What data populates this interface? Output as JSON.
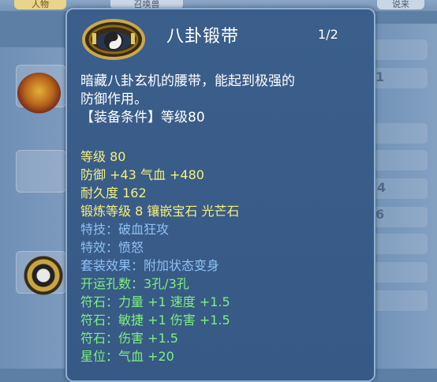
{
  "background": {
    "tabs": [
      "人物",
      "召唤兽",
      "说来"
    ],
    "digits": [
      "1",
      "4",
      "6"
    ]
  },
  "tooltip": {
    "item_name": "八卦锻带",
    "page_indicator": "1/2",
    "description_lines": [
      "暗藏八卦玄机的腰带，能起到极强的",
      "防御作用。"
    ],
    "requirement": "【装备条件】等级80",
    "stats": [
      {
        "text": "等级 80",
        "color": "yellow"
      },
      {
        "text": "防御 +43 气血 +480",
        "color": "yellow"
      },
      {
        "text": "耐久度 162",
        "color": "yellow"
      },
      {
        "text": "锻炼等级 8  镶嵌宝石 光芒石",
        "color": "yellow"
      },
      {
        "text": "特技：破血狂攻",
        "color": "blue"
      },
      {
        "text": "特效：愤怒",
        "color": "blue"
      },
      {
        "text": "套装效果：附加状态变身",
        "color": "blue"
      },
      {
        "text": "开运孔数：3孔/3孔",
        "color": "green"
      },
      {
        "text": "符石：力量 +1 速度 +1.5",
        "color": "green"
      },
      {
        "text": "符石：敏捷 +1 伤害 +1.5",
        "color": "green"
      },
      {
        "text": "符石：伤害 +1.5",
        "color": "green"
      },
      {
        "text": "星位：气血 +20",
        "color": "green"
      }
    ]
  },
  "colors": {
    "yellow": "#f5f17a",
    "blue": "#8ec1f2",
    "green": "#7df07d",
    "panel": "#3b5e8b",
    "border": "#8fb0d6"
  }
}
